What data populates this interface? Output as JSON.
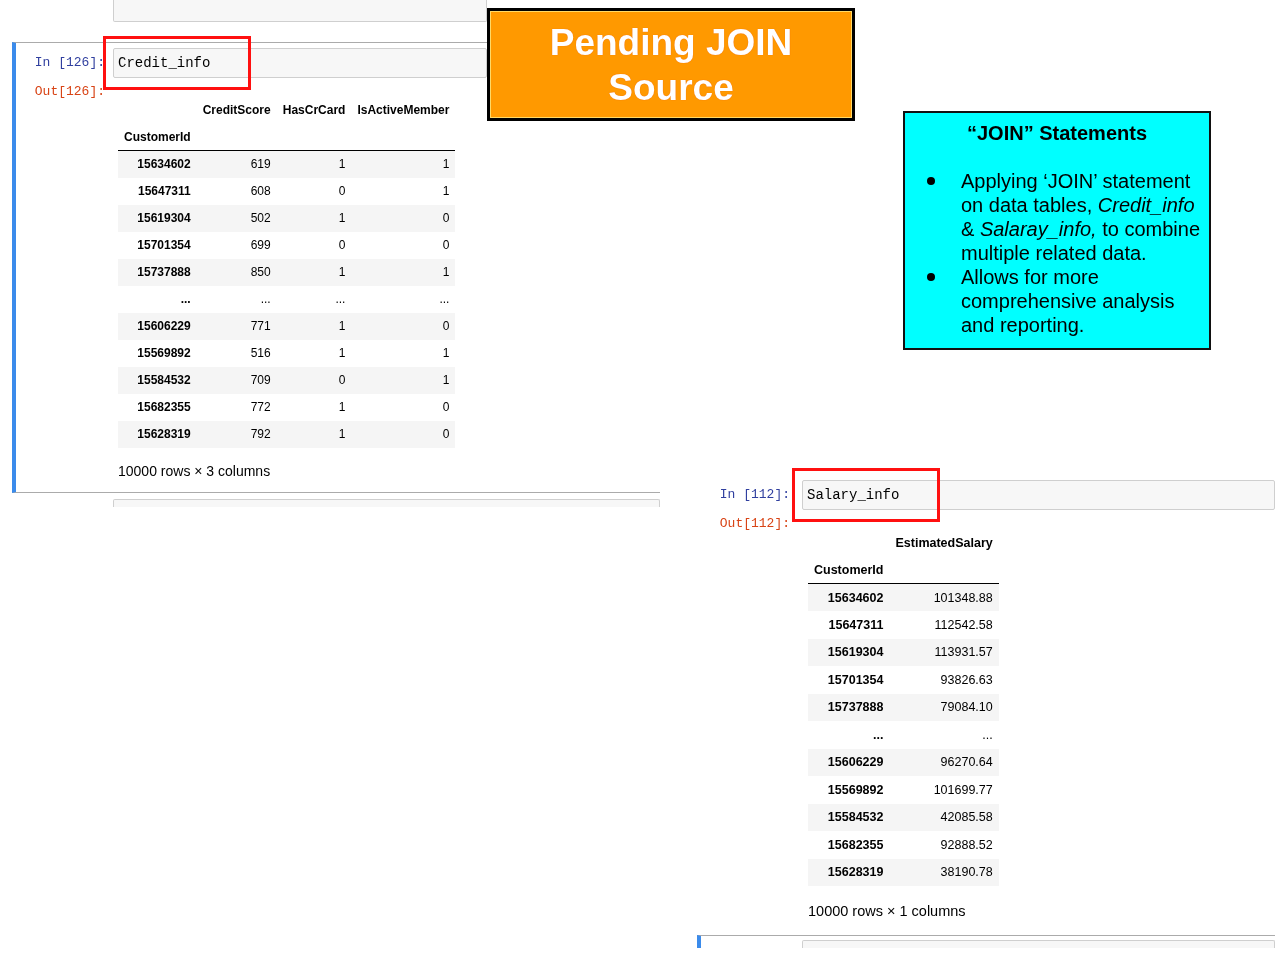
{
  "notebooks": [
    {
      "cells": [
        {
          "kind": "stub",
          "selected": false
        },
        {
          "kind": "code",
          "selected": true,
          "in_prompt": "In [126]:",
          "code": "Credit_info",
          "highlighted": true,
          "out_prompt": "Out[126]:",
          "table": {
            "index_name": "CustomerId",
            "columns": [
              "CreditScore",
              "HasCrCard",
              "IsActiveMember"
            ],
            "rows": [
              {
                "index": "15634602",
                "values": [
                  "619",
                  "1",
                  "1"
                ]
              },
              {
                "index": "15647311",
                "values": [
                  "608",
                  "0",
                  "1"
                ]
              },
              {
                "index": "15619304",
                "values": [
                  "502",
                  "1",
                  "0"
                ]
              },
              {
                "index": "15701354",
                "values": [
                  "699",
                  "0",
                  "0"
                ]
              },
              {
                "index": "15737888",
                "values": [
                  "850",
                  "1",
                  "1"
                ]
              },
              {
                "index": "...",
                "values": [
                  "...",
                  "...",
                  "..."
                ]
              },
              {
                "index": "15606229",
                "values": [
                  "771",
                  "1",
                  "0"
                ]
              },
              {
                "index": "15569892",
                "values": [
                  "516",
                  "1",
                  "1"
                ]
              },
              {
                "index": "15584532",
                "values": [
                  "709",
                  "0",
                  "1"
                ]
              },
              {
                "index": "15682355",
                "values": [
                  "772",
                  "1",
                  "0"
                ]
              },
              {
                "index": "15628319",
                "values": [
                  "792",
                  "1",
                  "0"
                ]
              }
            ]
          },
          "summary": "10000 rows × 3 columns"
        },
        {
          "kind": "stub",
          "selected": false
        }
      ]
    },
    {
      "cells": [
        {
          "kind": "code",
          "selected": false,
          "in_prompt": "In [112]:",
          "code": "Salary_info",
          "highlighted": true,
          "out_prompt": "Out[112]:",
          "table": {
            "index_name": "CustomerId",
            "columns": [
              "EstimatedSalary"
            ],
            "rows": [
              {
                "index": "15634602",
                "values": [
                  "101348.88"
                ]
              },
              {
                "index": "15647311",
                "values": [
                  "112542.58"
                ]
              },
              {
                "index": "15619304",
                "values": [
                  "113931.57"
                ]
              },
              {
                "index": "15701354",
                "values": [
                  "93826.63"
                ]
              },
              {
                "index": "15737888",
                "values": [
                  "79084.10"
                ]
              },
              {
                "index": "...",
                "values": [
                  "..."
                ]
              },
              {
                "index": "15606229",
                "values": [
                  "96270.64"
                ]
              },
              {
                "index": "15569892",
                "values": [
                  "101699.77"
                ]
              },
              {
                "index": "15584532",
                "values": [
                  "42085.58"
                ]
              },
              {
                "index": "15682355",
                "values": [
                  "92888.52"
                ]
              },
              {
                "index": "15628319",
                "values": [
                  "38190.78"
                ]
              }
            ]
          },
          "summary": "10000 rows × 1 columns"
        },
        {
          "kind": "stub",
          "selected": true
        }
      ]
    }
  ],
  "banner": {
    "title": "Pending JOIN Source"
  },
  "callout": {
    "title": "“JOIN” Statements",
    "bullets": [
      "Applying ‘JOIN’ statement on data tables, *Credit_info* & *Salaray_info,* to combine multiple related data.",
      "Allows for more comprehensive analysis and reporting."
    ]
  }
}
